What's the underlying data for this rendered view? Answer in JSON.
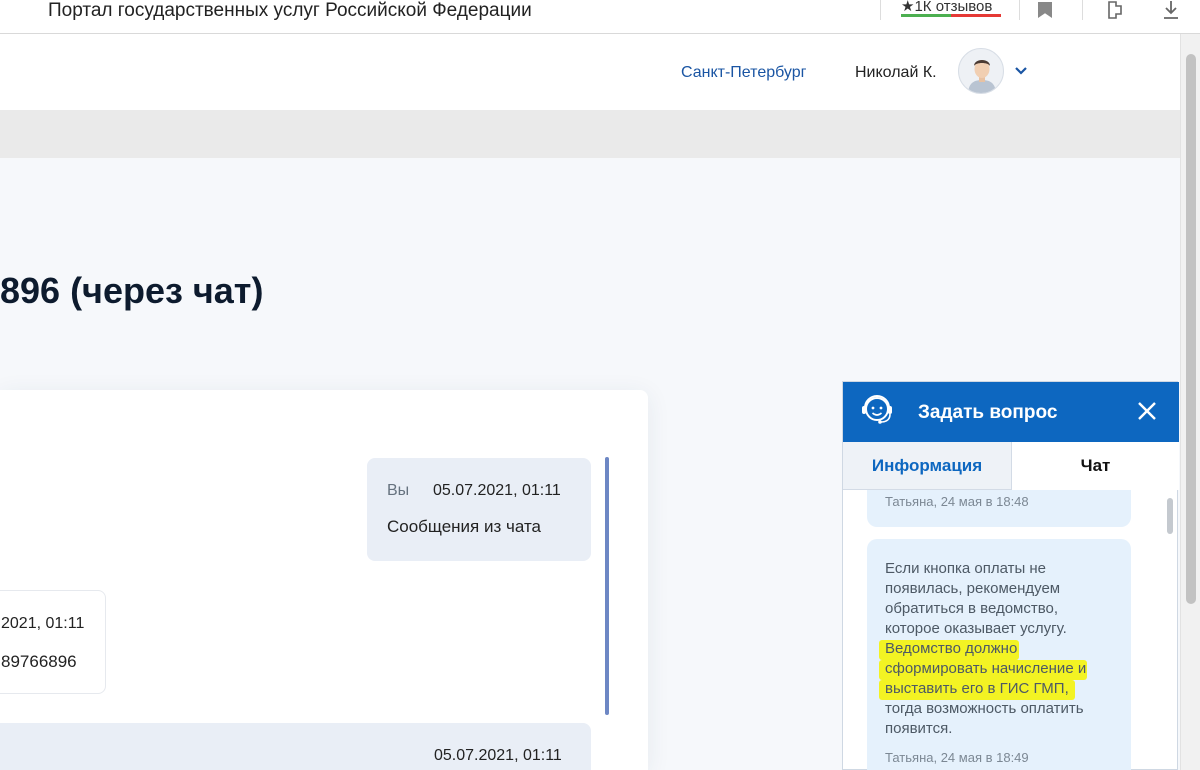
{
  "browser": {
    "title": "Портал государственных услуг Российской Федерации",
    "rating_label": "★1К отзывов"
  },
  "header": {
    "city": "Санкт-Петербург",
    "user_name": "Николай К."
  },
  "page": {
    "title": "896 (через чат)"
  },
  "chat": {
    "messages": [
      {
        "sender": "Вы",
        "time": "05.07.2021, 01:11",
        "text": "Сообщения из чата"
      },
      {
        "time": "2021, 01:11",
        "text": "89766896"
      },
      {
        "time": "05.07.2021, 01:11"
      }
    ]
  },
  "widget": {
    "title": "Задать вопрос",
    "tabs": [
      {
        "label": "Информация"
      },
      {
        "label": "Чат"
      }
    ],
    "bubbles": [
      {
        "meta": "Татьяна, 24 мая в 18:48"
      },
      {
        "lines": [
          "Если кнопка оплаты не",
          "появилась, рекомендуем",
          "обратиться в ведомство,",
          "которое оказывает услугу.",
          "Ведомство должно",
          "сформировать начисление и",
          "выставить его в ГИС ГМП,",
          "тогда возможность оплатить",
          "появится."
        ],
        "meta": "Татьяна, 24 мая в 18:49"
      }
    ]
  },
  "colors": {
    "accent": "#0d67c0",
    "link": "#1a55a3",
    "highlight": "#f3f323",
    "bubble": "#e5f1fc"
  }
}
